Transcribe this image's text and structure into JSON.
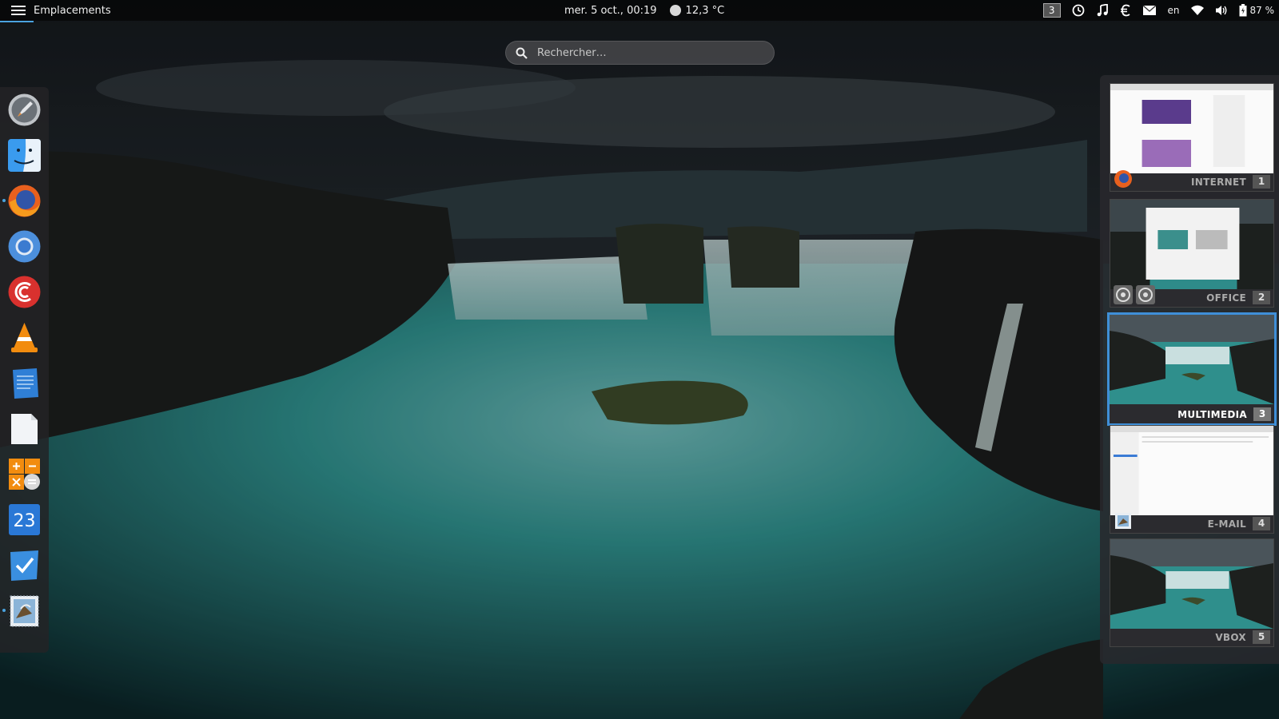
{
  "topbar": {
    "places_label": "Emplacements",
    "datetime": "mer.  5 oct., 00:19",
    "temperature": "12,3 °C",
    "workspace_indicator": "3",
    "language": "en",
    "battery": "87 %"
  },
  "search": {
    "placeholder": "Rechercher…"
  },
  "dash": {
    "items": [
      {
        "icon": "rocket-icon",
        "running": false
      },
      {
        "icon": "finder-icon",
        "running": false
      },
      {
        "icon": "firefox-icon",
        "running": true
      },
      {
        "icon": "chromium-icon",
        "running": false
      },
      {
        "icon": "torrent-icon",
        "running": false
      },
      {
        "icon": "vlc-icon",
        "running": false
      },
      {
        "icon": "notes-icon",
        "running": false
      },
      {
        "icon": "document-icon",
        "running": false
      },
      {
        "icon": "calculator-icon",
        "running": false
      },
      {
        "icon": "calendar-icon",
        "running": false,
        "text": "23"
      },
      {
        "icon": "tasks-icon",
        "running": false
      },
      {
        "icon": "mail-icon",
        "running": true
      }
    ]
  },
  "workspaces": [
    {
      "label": "INTERNET",
      "number": "1",
      "active": false
    },
    {
      "label": "OFFICE",
      "number": "2",
      "active": false
    },
    {
      "label": "MULTIMEDIA",
      "number": "3",
      "active": true
    },
    {
      "label": "E-MAIL",
      "number": "4",
      "active": false
    },
    {
      "label": "VBOX",
      "number": "5",
      "active": false
    }
  ],
  "colors": {
    "accent": "#3f8fd8",
    "water": "#2f8f8c"
  }
}
